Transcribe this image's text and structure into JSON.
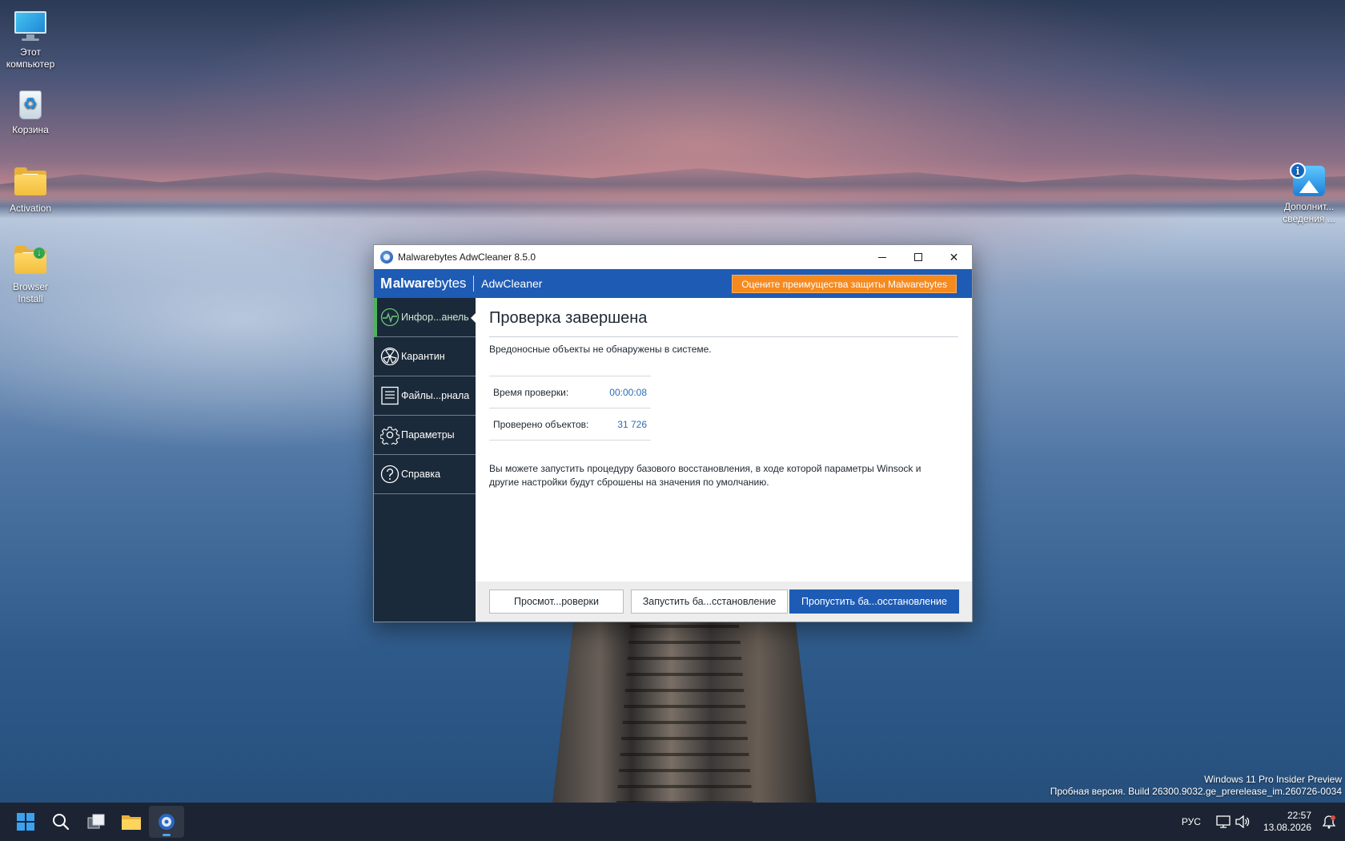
{
  "desktop": {
    "icons": [
      {
        "label": "Этот компьютер",
        "icon": "this-pc-icon"
      },
      {
        "label": "Корзина",
        "icon": "recycle-bin-icon"
      },
      {
        "label": "Activation",
        "icon": "folder-icon"
      },
      {
        "label": "Browser Install",
        "icon": "folder-icon"
      },
      {
        "label": "Дополнит... сведения ...",
        "icon": "info-image-icon"
      }
    ],
    "watermark": {
      "line1": "Windows 11 Pro Insider Preview",
      "line2": "Пробная версия. Build 26300.9032.ge_prerelease_im.260726-0034"
    }
  },
  "window": {
    "title": "Malwarebytes AdwCleaner 8.5.0",
    "controls": {
      "minimize": "minimize-icon",
      "maximize": "maximize-icon",
      "close": "✕"
    },
    "brand": {
      "logo_bold": "alware",
      "logo_m": "M",
      "logo_light": "bytes",
      "product": "AdwCleaner",
      "promo_button": "Оцените преимущества защиты Malwarebytes",
      "brand_color": "#1e5bb5",
      "promo_color": "#f68a1e"
    },
    "sidebar": {
      "items": [
        {
          "label": "Инфор...анель",
          "icon": "dashboard-pulse-icon",
          "active": true
        },
        {
          "label": "Карантин",
          "icon": "quarantine-hazard-icon",
          "active": false
        },
        {
          "label": "Файлы...рнала",
          "icon": "log-files-icon",
          "active": false
        },
        {
          "label": "Параметры",
          "icon": "gear-icon",
          "active": false
        },
        {
          "label": "Справка",
          "icon": "help-question-icon",
          "active": false
        }
      ],
      "accent_color": "#4fb35d"
    },
    "main": {
      "heading": "Проверка завершена",
      "subtext": "Вредоносные объекты не обнаружены в системе.",
      "stats": [
        {
          "label": "Время проверки:",
          "value": "00:00:08"
        },
        {
          "label": "Проверено объектов:",
          "value": "31 726"
        }
      ],
      "paragraph": "Вы можете запустить процедуру базового восстановления, в ходе которой параметры Winsock и другие настройки будут сброшены на значения по умолчанию."
    },
    "footer": {
      "view_button": "Просмот...роверки",
      "run_button": "Запустить ба...сстановление",
      "skip_button": "Пропустить ба...осстановление"
    }
  },
  "taskbar": {
    "apps": [
      "start-icon",
      "search-icon",
      "task-view-icon",
      "file-explorer-icon",
      "adwcleaner-icon"
    ],
    "language": "РУС",
    "time": "22:57",
    "date": "13.08.2026"
  }
}
